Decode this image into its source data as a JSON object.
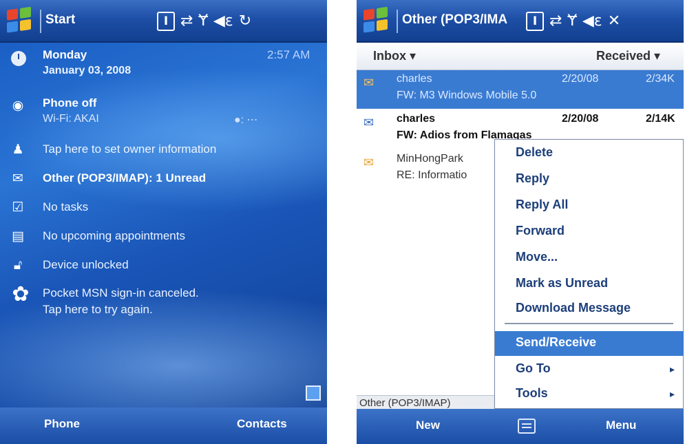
{
  "left": {
    "title": "Start",
    "date_line1": "Monday",
    "date_line2": "January 03, 2008",
    "time": "2:57 AM",
    "phone_status": "Phone off",
    "wifi_status": "Wi-Fi: AKAI",
    "owner_info": "Tap here to set owner information",
    "email_status": "Other (POP3/IMAP): 1 Unread",
    "tasks": "No tasks",
    "appointments": "No upcoming appointments",
    "device_lock": "Device unlocked",
    "msn_line1": "Pocket MSN sign-in canceled.",
    "msn_line2": "Tap here to try again.",
    "softkey_left": "Phone",
    "softkey_right": "Contacts"
  },
  "right": {
    "title": "Other (POP3/IMA",
    "folder": "Inbox ▾",
    "sort": "Received ▾",
    "messages": [
      {
        "from": "charles",
        "date": "2/20/08",
        "size": "2/34K",
        "subject": "FW: M3 Windows Mobile 5.0"
      },
      {
        "from": "charles",
        "date": "2/20/08",
        "size": "2/14K",
        "subject": "FW: Adios from Flamagas"
      },
      {
        "from": "MinHongPark",
        "date": "",
        "size": "",
        "subject": "RE: Informatio"
      }
    ],
    "status_account": "Other (POP3/IMAP)",
    "menu_items": [
      "Delete",
      "Reply",
      "Reply All",
      "Forward",
      "Move...",
      "Mark as Unread",
      "Download Message",
      "Send/Receive",
      "Go To",
      "Tools"
    ],
    "softkey_left": "New",
    "softkey_right": "Menu"
  }
}
